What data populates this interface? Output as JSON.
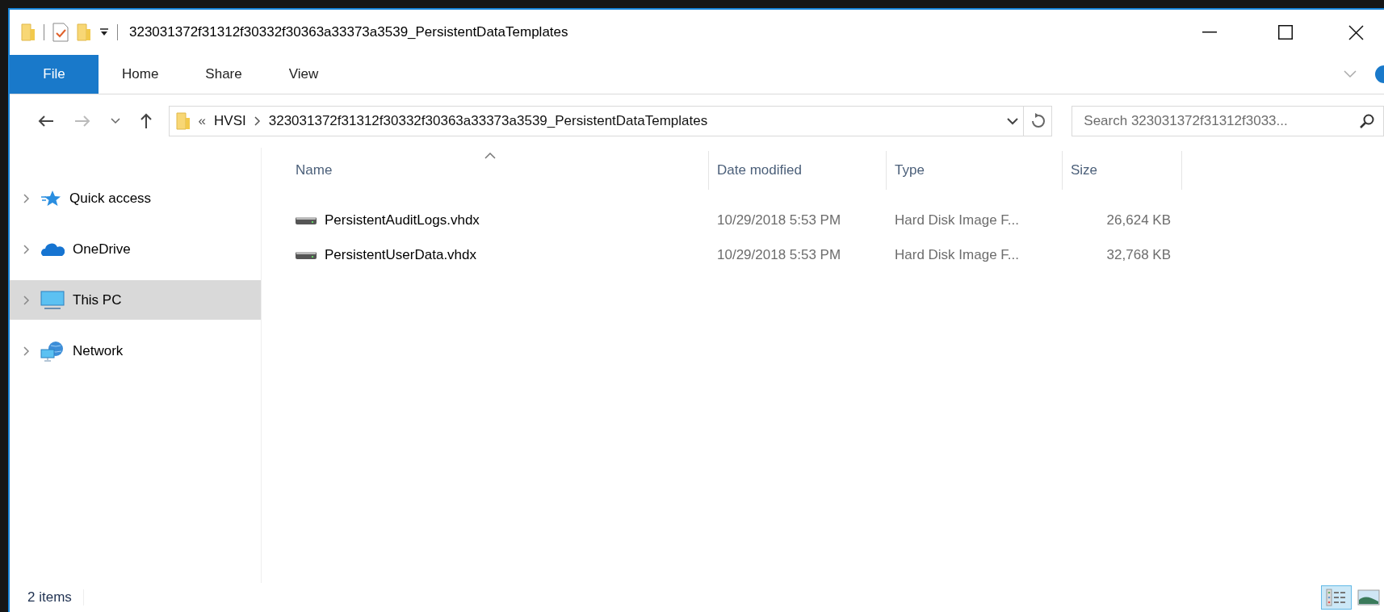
{
  "window": {
    "title": "323031372f31312f30332f30363a33373a3539_PersistentDataTemplates"
  },
  "ribbon": {
    "tabs": [
      {
        "label": "File",
        "selected": true
      },
      {
        "label": "Home",
        "selected": false
      },
      {
        "label": "Share",
        "selected": false
      },
      {
        "label": "View",
        "selected": false
      }
    ]
  },
  "address_bar": {
    "overflow_marker": "«",
    "segments": [
      "HVSI",
      "323031372f31312f30332f30363a33373a3539_PersistentDataTemplates"
    ]
  },
  "search": {
    "placeholder": "Search 323031372f31312f3033..."
  },
  "navigation": {
    "items": [
      {
        "label": "Quick access",
        "kind": "quick_access",
        "selected": false
      },
      {
        "label": "OneDrive",
        "kind": "cloud",
        "selected": false
      },
      {
        "label": "This PC",
        "kind": "computer",
        "selected": true
      },
      {
        "label": "Network",
        "kind": "network",
        "selected": false
      }
    ]
  },
  "file_list": {
    "columns": [
      {
        "label": "Name",
        "sorted": true
      },
      {
        "label": "Date modified",
        "sorted": false
      },
      {
        "label": "Type",
        "sorted": false
      },
      {
        "label": "Size",
        "sorted": false
      }
    ],
    "rows": [
      {
        "name": "PersistentAuditLogs.vhdx",
        "date_modified": "10/29/2018 5:53 PM",
        "type": "Hard Disk Image F...",
        "size": "26,624 KB"
      },
      {
        "name": "PersistentUserData.vhdx",
        "date_modified": "10/29/2018 5:53 PM",
        "type": "Hard Disk Image F...",
        "size": "32,768 KB"
      }
    ]
  },
  "status_bar": {
    "item_count": "2 items",
    "views": [
      {
        "kind": "details",
        "selected": true
      },
      {
        "kind": "large_icons",
        "selected": false
      }
    ]
  }
}
